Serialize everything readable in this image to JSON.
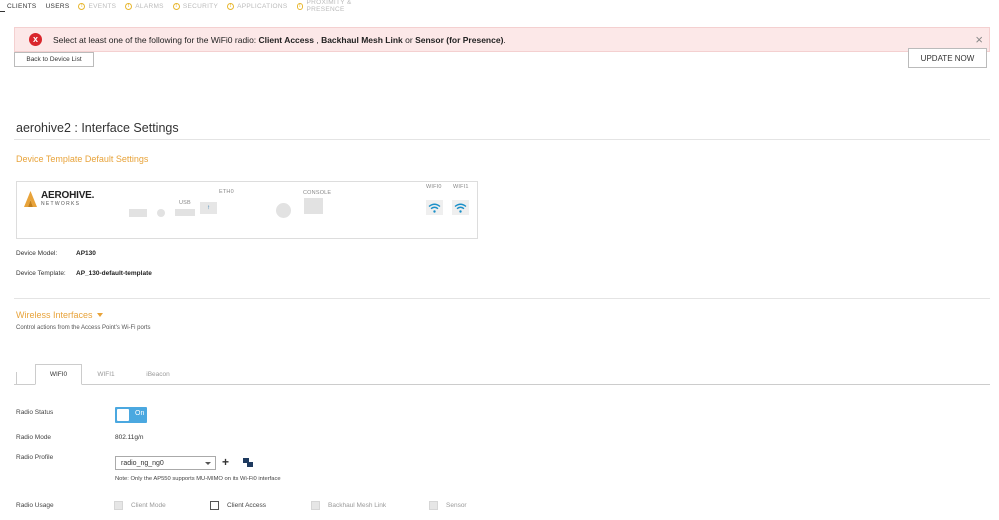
{
  "top_nav": {
    "items": [
      {
        "label": "CLIENTS",
        "warn": false,
        "active": true
      },
      {
        "label": "USERS",
        "warn": false,
        "active": false
      },
      {
        "label": "EVENTS",
        "warn": true,
        "active": false
      },
      {
        "label": "ALARMS",
        "warn": true,
        "active": false
      },
      {
        "label": "SECURITY",
        "warn": true,
        "active": false
      },
      {
        "label": "APPLICATIONS",
        "warn": true,
        "active": false
      },
      {
        "label": "PROXIMITY & PRESENCE",
        "warn": true,
        "active": false
      }
    ]
  },
  "alert": {
    "icon": "x",
    "prefix": "Select at least one of the following for the WiFi0 radio: ",
    "opt1": "Client Access",
    "sep1": " , ",
    "opt2": "Backhaul Mesh Link",
    "sep2": " or ",
    "opt3": "Sensor (for Presence)",
    "suffix": ".",
    "close": "×"
  },
  "actions": {
    "back_label": "Back to Device List",
    "update_label": "UPDATE NOW"
  },
  "page": {
    "title": "aerohive2 : Interface Settings",
    "template_section": "Device Template Default Settings"
  },
  "device": {
    "logo_line1": "AEROHIVE.",
    "logo_line2": "NETWORKS",
    "usb_label": "USB",
    "eth_label": "ETH0",
    "eth_glyph": "↑",
    "console_label": "CONSOLE",
    "wifi0_label": "WIFI0",
    "wifi1_label": "WIFI1",
    "model_label": "Device Model:",
    "model_value": "AP130",
    "template_label": "Device Template:",
    "template_value": "AP_130-default-template"
  },
  "wireless": {
    "title": "Wireless Interfaces",
    "subtitle": "Control actions from the Access Point's Wi-Fi ports",
    "tabs": [
      "WIFI0",
      "WIFI1",
      "iBeacon"
    ]
  },
  "form": {
    "radio_status_label": "Radio Status",
    "radio_status_value": "On",
    "radio_mode_label": "Radio Mode",
    "radio_mode_value": "802.11g/n",
    "radio_profile_label": "Radio Profile",
    "radio_profile_value": "radio_ng_ng0",
    "plus": "+",
    "note": "Note: Only the AP550 supports MU-MIMO on its Wi-Fi0 interface",
    "radio_usage_label": "Radio Usage",
    "usage_options": [
      {
        "label": "Client Mode",
        "enabled": false
      },
      {
        "label": "Client Access",
        "enabled": true
      },
      {
        "label": "Backhaul Mesh Link",
        "enabled": false
      },
      {
        "label": "Sensor",
        "enabled": false
      }
    ]
  },
  "colors": {
    "accent_orange": "#e8a33a",
    "toggle_blue": "#4ba8e0",
    "error_red": "#d9262c",
    "alert_bg": "#fce8e8",
    "wifi_blue": "#1a8fc8"
  }
}
